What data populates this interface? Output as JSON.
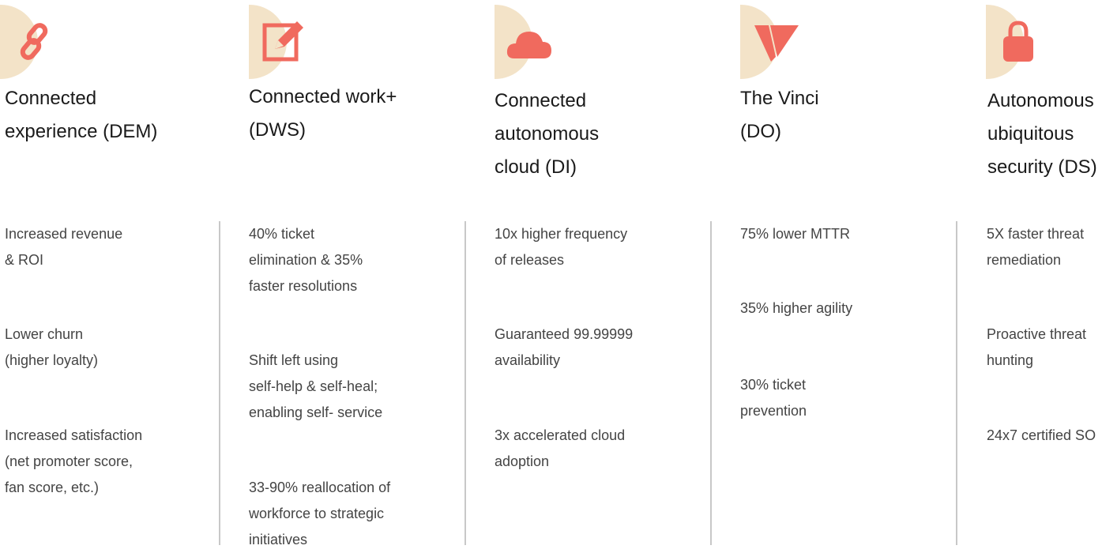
{
  "colors": {
    "accent": "#f06a5e",
    "decor": "#f3e3c8",
    "divider": "#c8c8c8"
  },
  "columns": [
    {
      "icon": "chain-link-icon",
      "title": "Connected\nexperience (DEM)",
      "items": [
        "Increased revenue\n& ROI",
        "Lower churn\n(higher loyalty)",
        "Increased satisfaction\n(net promoter score,\nfan score, etc.)"
      ]
    },
    {
      "icon": "edit-pencil-icon",
      "title": "Connected work+\n(DWS)",
      "items": [
        "40% ticket\nelimination & 35%\nfaster resolutions",
        "Shift left using\nself-help & self-heal;\nenabling self- service",
        "33-90% reallocation of\nworkforce to strategic\ninitiatives"
      ]
    },
    {
      "icon": "cloud-icon",
      "title": "Connected\nautonomous\ncloud (DI)",
      "items": [
        "10x higher frequency\nof releases",
        "Guaranteed 99.99999\navailability",
        "3x accelerated cloud\nadoption"
      ]
    },
    {
      "icon": "vinci-logo-icon",
      "title": "The Vinci\n(DO)",
      "items": [
        "75% lower MTTR",
        "35% higher agility",
        "30% ticket\nprevention"
      ]
    },
    {
      "icon": "padlock-icon",
      "title": "Autonomous\nubiquitous\nsecurity (DS)",
      "items": [
        "5X faster threat\nremediation",
        "Proactive threat\nhunting",
        "24x7 certified SO"
      ]
    }
  ]
}
